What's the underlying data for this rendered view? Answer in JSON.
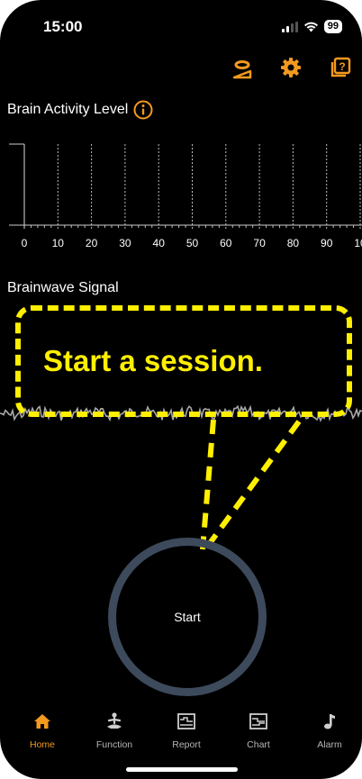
{
  "status_bar": {
    "time": "15:00",
    "battery": "99"
  },
  "header_icons": [
    "headband-device-icon",
    "gear-icon",
    "help-icon"
  ],
  "brain_activity": {
    "title": "Brain Activity Level",
    "x_ticks": [
      "0",
      "10",
      "20",
      "30",
      "40",
      "50",
      "60",
      "70",
      "80",
      "90",
      "10"
    ]
  },
  "brainwave_signal": {
    "title": "Brainwave Signal"
  },
  "callout": {
    "text": "Start a session."
  },
  "start_button": {
    "label": "Start"
  },
  "tabs": [
    {
      "label": "Home",
      "icon": "home-icon",
      "active": true
    },
    {
      "label": "Function",
      "icon": "meditation-icon",
      "active": false
    },
    {
      "label": "Report",
      "icon": "report-icon",
      "active": false
    },
    {
      "label": "Chart",
      "icon": "chart-icon",
      "active": false
    },
    {
      "label": "Alarm",
      "icon": "music-note-icon",
      "active": false
    }
  ],
  "colors": {
    "accent": "#f39a1e",
    "callout": "#ffef00",
    "ring": "#3d4a5c",
    "background": "#000000"
  }
}
